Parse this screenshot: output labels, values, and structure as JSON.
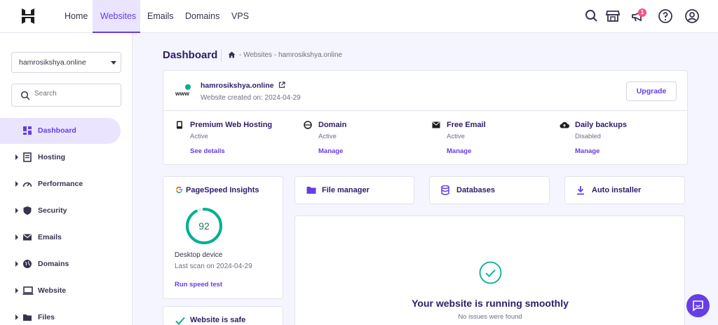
{
  "nav": {
    "items": [
      "Home",
      "Websites",
      "Emails",
      "Domains",
      "VPS"
    ],
    "active": "Websites",
    "notification_count": "1"
  },
  "sidebar": {
    "selected_site": "hamrosikshya.online",
    "search_placeholder": "Search",
    "items": [
      {
        "label": "Dashboard",
        "icon": "dashboard-icon",
        "active": true
      },
      {
        "label": "Hosting",
        "icon": "hosting-icon"
      },
      {
        "label": "Performance",
        "icon": "speedometer-icon"
      },
      {
        "label": "Security",
        "icon": "shield-icon"
      },
      {
        "label": "Emails",
        "icon": "mail-icon"
      },
      {
        "label": "Domains",
        "icon": "globe-icon"
      },
      {
        "label": "Website",
        "icon": "laptop-icon"
      },
      {
        "label": "Files",
        "icon": "folder-icon"
      }
    ]
  },
  "page": {
    "title": "Dashboard",
    "breadcrumb": "- Websites - hamrosikshya.online"
  },
  "site": {
    "icon_text": "www",
    "name": "hamrosikshya.online",
    "created": "Website created on: 2024-04-29",
    "upgrade_label": "Upgrade"
  },
  "services": [
    {
      "title": "Premium Web Hosting",
      "status": "Active",
      "link": "See details",
      "icon": "server-icon"
    },
    {
      "title": "Domain",
      "status": "Active",
      "link": "Manage",
      "icon": "globe-icon"
    },
    {
      "title": "Free Email",
      "status": "Active",
      "link": "Manage",
      "icon": "mail-icon"
    },
    {
      "title": "Daily backups",
      "status": "Disabled",
      "link": "Manage",
      "icon": "cloud-upload-icon"
    }
  ],
  "pagespeed": {
    "title": "PageSpeed Insights",
    "score": "92",
    "score_fraction": 0.92,
    "device": "Desktop device",
    "last_scan": "Last scan on 2024-04-29",
    "link": "Run speed test"
  },
  "tools": [
    {
      "label": "File manager",
      "icon": "folder-icon"
    },
    {
      "label": "Databases",
      "icon": "database-icon"
    },
    {
      "label": "Auto installer",
      "icon": "download-icon"
    }
  ],
  "status": {
    "title": "Your website is running smoothly",
    "subtitle": "No issues were found"
  },
  "safety": {
    "title": "Website is safe"
  },
  "colors": {
    "accent": "#673de6",
    "accent_light": "#ebe4ff",
    "success": "#00b090",
    "text": "#2f1c6a",
    "muted": "#6d7081"
  }
}
